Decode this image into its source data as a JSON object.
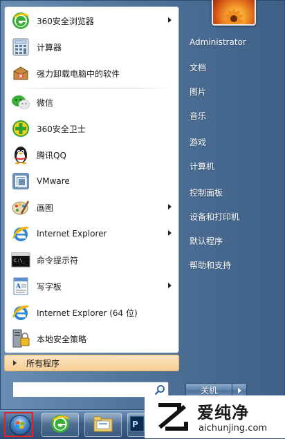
{
  "programs": [
    {
      "label": "360安全浏览器",
      "icon": "360-browser-icon",
      "submenu": true
    },
    {
      "label": "计算器",
      "icon": "calculator-icon",
      "submenu": false
    },
    {
      "label": "强力卸载电脑中的软件",
      "icon": "uninstaller-icon",
      "submenu": false
    },
    {
      "label": "微信",
      "icon": "wechat-icon",
      "submenu": false
    },
    {
      "label": "360安全卫士",
      "icon": "360-safeguard-icon",
      "submenu": false
    },
    {
      "label": "腾讯QQ",
      "icon": "qq-penguin-icon",
      "submenu": false
    },
    {
      "label": "VMware",
      "icon": "vmware-icon",
      "submenu": false
    },
    {
      "label": "画图",
      "icon": "paint-icon",
      "submenu": true
    },
    {
      "label": "Internet Explorer",
      "icon": "internet-explorer-icon",
      "submenu": true
    },
    {
      "label": "命令提示符",
      "icon": "command-prompt-icon",
      "submenu": false
    },
    {
      "label": "写字板",
      "icon": "wordpad-icon",
      "submenu": true
    },
    {
      "label": "Internet Explorer (64 位)",
      "icon": "internet-explorer-icon",
      "submenu": false
    },
    {
      "label": "本地安全策略",
      "icon": "security-policy-icon",
      "submenu": false
    }
  ],
  "all_programs_label": "所有程序",
  "search": {
    "value": "",
    "placeholder": ""
  },
  "right_menu": {
    "items": [
      {
        "label": "Administrator"
      },
      {
        "label": "文档"
      },
      {
        "label": "图片"
      },
      {
        "label": "音乐"
      },
      {
        "label": "游戏"
      },
      {
        "label": "计算机"
      },
      {
        "label": "控制面板"
      },
      {
        "label": "设备和打印机"
      },
      {
        "label": "默认程序"
      },
      {
        "label": "帮助和支持"
      }
    ]
  },
  "shutdown_label": "关机",
  "taskbar": {
    "buttons": [
      {
        "icon": "360-browser-icon"
      },
      {
        "icon": "file-explorer-icon"
      },
      {
        "icon": "photoshop-icon"
      }
    ]
  },
  "watermark": {
    "title": "爱纯净",
    "url": "aichunjing.com"
  },
  "colors": {
    "menu_bg": "#4f7299",
    "left_pane_bg": "#ffffff",
    "all_programs_bg": "#f7cf96",
    "taskbar_bg": "#3c5f88",
    "orb_highlight": "#e0242a"
  }
}
